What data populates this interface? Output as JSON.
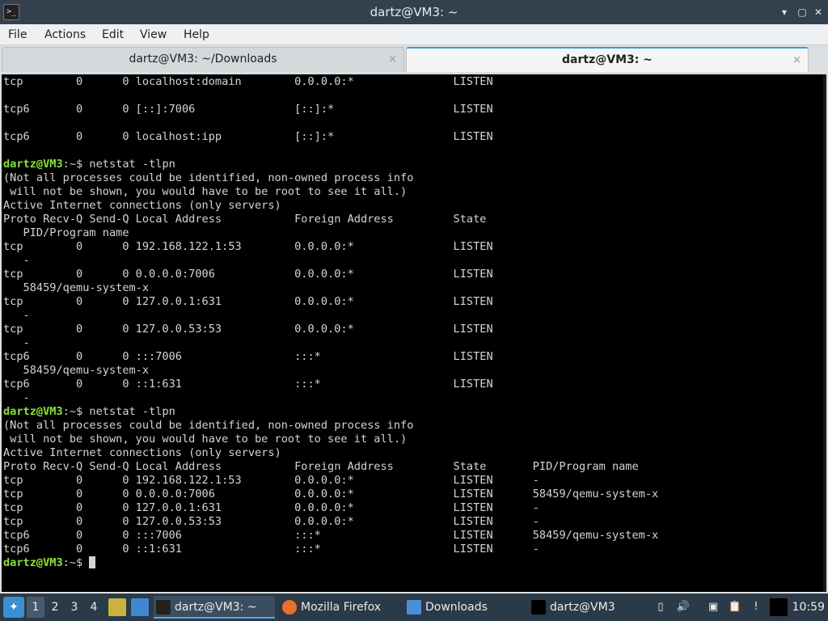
{
  "window": {
    "title": "dartz@VM3: ~",
    "app_icon": "terminal-icon",
    "minimize_glyph": "▾",
    "maximize_glyph": "▢",
    "close_glyph": "✕"
  },
  "menubar": {
    "items": [
      {
        "label": "File"
      },
      {
        "label": "Actions"
      },
      {
        "label": "Edit"
      },
      {
        "label": "View"
      },
      {
        "label": "Help"
      }
    ]
  },
  "tabs": [
    {
      "label": "dartz@VM3: ~/Downloads",
      "active": false,
      "close": "×"
    },
    {
      "label": "dartz@VM3: ~",
      "active": true,
      "close": "×"
    }
  ],
  "terminal": {
    "prompt_user": "dartz@VM3",
    "prompt_path": ":~$ ",
    "lines": [
      {
        "type": "text",
        "text": "tcp        0      0 localhost:domain        0.0.0.0:*               LISTEN"
      },
      {
        "type": "text",
        "text": ""
      },
      {
        "type": "text",
        "text": "tcp6       0      0 [::]:7006               [::]:*                  LISTEN"
      },
      {
        "type": "text",
        "text": ""
      },
      {
        "type": "text",
        "text": "tcp6       0      0 localhost:ipp           [::]:*                  LISTEN"
      },
      {
        "type": "text",
        "text": ""
      },
      {
        "type": "prompt",
        "text": "netstat -tlpn"
      },
      {
        "type": "text",
        "text": "(Not all processes could be identified, non-owned process info"
      },
      {
        "type": "text",
        "text": " will not be shown, you would have to be root to see it all.)"
      },
      {
        "type": "text",
        "text": "Active Internet connections (only servers)"
      },
      {
        "type": "text",
        "text": "Proto Recv-Q Send-Q Local Address           Foreign Address         State"
      },
      {
        "type": "text",
        "text": "   PID/Program name"
      },
      {
        "type": "text",
        "text": "tcp        0      0 192.168.122.1:53        0.0.0.0:*               LISTEN"
      },
      {
        "type": "text",
        "text": "   -"
      },
      {
        "type": "text",
        "text": "tcp        0      0 0.0.0.0:7006            0.0.0.0:*               LISTEN"
      },
      {
        "type": "text",
        "text": "   58459/qemu-system-x"
      },
      {
        "type": "text",
        "text": "tcp        0      0 127.0.0.1:631           0.0.0.0:*               LISTEN"
      },
      {
        "type": "text",
        "text": "   -"
      },
      {
        "type": "text",
        "text": "tcp        0      0 127.0.0.53:53           0.0.0.0:*               LISTEN"
      },
      {
        "type": "text",
        "text": "   -"
      },
      {
        "type": "text",
        "text": "tcp6       0      0 :::7006                 :::*                    LISTEN"
      },
      {
        "type": "text",
        "text": "   58459/qemu-system-x"
      },
      {
        "type": "text",
        "text": "tcp6       0      0 ::1:631                 :::*                    LISTEN"
      },
      {
        "type": "text",
        "text": "   -"
      },
      {
        "type": "prompt",
        "text": "netstat -tlpn"
      },
      {
        "type": "text",
        "text": "(Not all processes could be identified, non-owned process info"
      },
      {
        "type": "text",
        "text": " will not be shown, you would have to be root to see it all.)"
      },
      {
        "type": "text",
        "text": "Active Internet connections (only servers)"
      },
      {
        "type": "text",
        "text": "Proto Recv-Q Send-Q Local Address           Foreign Address         State       PID/Program name"
      },
      {
        "type": "text",
        "text": "tcp        0      0 192.168.122.1:53        0.0.0.0:*               LISTEN      -"
      },
      {
        "type": "text",
        "text": "tcp        0      0 0.0.0.0:7006            0.0.0.0:*               LISTEN      58459/qemu-system-x"
      },
      {
        "type": "text",
        "text": "tcp        0      0 127.0.0.1:631           0.0.0.0:*               LISTEN      -"
      },
      {
        "type": "text",
        "text": "tcp        0      0 127.0.0.53:53           0.0.0.0:*               LISTEN      -"
      },
      {
        "type": "text",
        "text": "tcp6       0      0 :::7006                 :::*                    LISTEN      58459/qemu-system-x"
      },
      {
        "type": "text",
        "text": "tcp6       0      0 ::1:631                 :::*                    LISTEN      -"
      },
      {
        "type": "prompt",
        "text": "",
        "cursor": true
      }
    ]
  },
  "taskbar": {
    "start_icon": "start-menu-icon",
    "workspaces": [
      "1",
      "2",
      "3",
      "4"
    ],
    "active_workspace": 0,
    "launchers": [
      {
        "name": "file-manager-launcher-icon",
        "color": "#c9b23f"
      },
      {
        "name": "show-desktop-icon",
        "color": "#3f88d0"
      }
    ],
    "tasks": [
      {
        "label": "dartz@VM3: ~",
        "icon": "terminal-icon",
        "active": true,
        "color": "#222222"
      },
      {
        "label": "Mozilla Firefox",
        "icon": "firefox-icon",
        "active": false,
        "color": "#e8712b"
      },
      {
        "label": "Downloads",
        "icon": "folder-icon",
        "active": false,
        "color": "#4a90d9"
      },
      {
        "label": "dartz@VM3",
        "icon": "terminal-graph-icon",
        "active": false,
        "color": "#000000"
      }
    ],
    "tray": [
      {
        "name": "removable-media-icon",
        "glyph": "▯"
      },
      {
        "name": "volume-icon",
        "glyph": "🔊"
      },
      {
        "name": "network-icon",
        "glyph": "▣"
      },
      {
        "name": "clipboard-icon",
        "glyph": "📋"
      },
      {
        "name": "update-notifier-icon",
        "glyph": "!"
      }
    ],
    "clock": "10:59"
  }
}
